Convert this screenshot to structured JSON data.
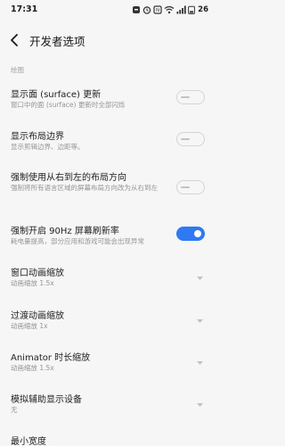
{
  "status_bar": {
    "time": "17:31",
    "battery": "26",
    "icons": [
      "notification-icon",
      "alarm-icon",
      "nfc-icon",
      "wifi-icon",
      "signal-icon",
      "battery-icon"
    ]
  },
  "header": {
    "title": "开发者选项"
  },
  "section": {
    "label": "绘图"
  },
  "settings": [
    {
      "title": "显示面 (surface) 更新",
      "desc": "窗口中的面 (surface) 更新时全部闪烁",
      "control": "toggle",
      "state": "off"
    },
    {
      "title": "显示布局边界",
      "desc": "显示剪辑边界、边距等。",
      "control": "toggle",
      "state": "off"
    },
    {
      "title": "强制使用从右到左的布局方向",
      "desc": "强制将所有语言区域的屏幕布局方向改为从右到左",
      "control": "toggle",
      "state": "off"
    },
    {
      "title": "强制开启 90Hz 屏幕刷新率",
      "desc": "耗电量提高，部分应用和游戏可能会出现异常",
      "control": "toggle",
      "state": "on"
    },
    {
      "title": "窗口动画缩放",
      "desc": "动画缩放 1.5x",
      "control": "dropdown"
    },
    {
      "title": "过渡动画缩放",
      "desc": "动画缩放 1x",
      "control": "dropdown"
    },
    {
      "title": "Animator 时长缩放",
      "desc": "动画缩放 1.5x",
      "control": "dropdown"
    },
    {
      "title": "模拟辅助显示设备",
      "desc": "无",
      "control": "dropdown"
    },
    {
      "title": "最小宽度",
      "desc": "",
      "control": "none"
    }
  ],
  "colors": {
    "accent": "#2f79f2",
    "background": "#f6f6f6",
    "secondary_text": "#959595"
  }
}
